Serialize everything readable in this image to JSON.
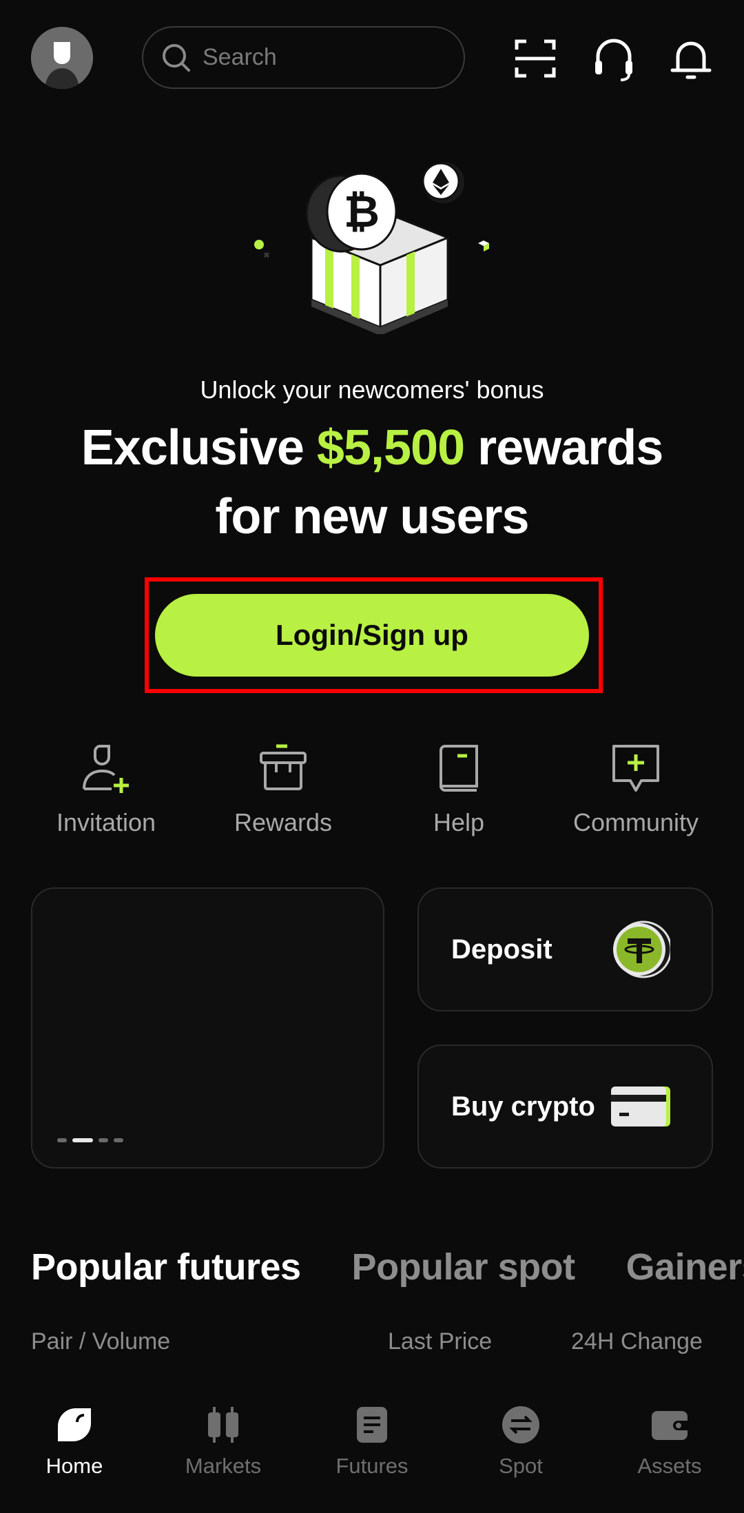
{
  "header": {
    "search_placeholder": "Search",
    "icons": [
      "avatar",
      "scan-icon",
      "headset-icon",
      "bell-icon"
    ]
  },
  "hero": {
    "subtitle": "Unlock your newcomers' bonus",
    "headline_prefix": "Exclusive ",
    "headline_amount": "$5,500",
    "headline_suffix": " rewards",
    "headline_line2": "for new users",
    "login_label": "Login/Sign up"
  },
  "shortcuts": [
    {
      "label": "Invitation",
      "icon": "invite-user-icon"
    },
    {
      "label": "Rewards",
      "icon": "gift-box-icon"
    },
    {
      "label": "Help",
      "icon": "book-icon"
    },
    {
      "label": "Community",
      "icon": "chat-plus-icon"
    }
  ],
  "cards": {
    "deposit": "Deposit",
    "buy_crypto": "Buy crypto"
  },
  "tabs": [
    "Popular futures",
    "Popular spot",
    "Gainers"
  ],
  "columns": {
    "pair": "Pair / Volume",
    "last_price": "Last Price",
    "change": "24H Change"
  },
  "bottom_nav": [
    {
      "label": "Home",
      "active": true
    },
    {
      "label": "Markets",
      "active": false
    },
    {
      "label": "Futures",
      "active": false
    },
    {
      "label": "Spot",
      "active": false
    },
    {
      "label": "Assets",
      "active": false
    }
  ],
  "colors": {
    "accent": "#b8f043",
    "background": "#0b0b0b",
    "highlight_outline": "#ff0000"
  }
}
